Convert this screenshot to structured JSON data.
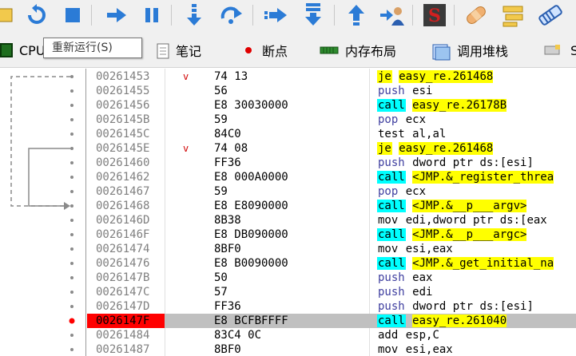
{
  "tabs": {
    "items": [
      {
        "label": "CPU"
      },
      {
        "label": "笔记"
      },
      {
        "label": "断点"
      },
      {
        "label": "内存布局"
      },
      {
        "label": "调用堆栈"
      },
      {
        "label": "S"
      }
    ]
  },
  "tooltip": "重新运行(S)",
  "toolbar": {
    "icons": [
      "open-file-icon",
      "restart-icon",
      "stop-icon",
      "run-icon",
      "pause-icon",
      "step-into-icon",
      "step-over-icon",
      "trace-into-icon",
      "trace-over-icon",
      "execute-till-return-icon",
      "run-to-user-code-icon",
      "script-icon",
      "patch-icon",
      "comment-icon",
      "label-icon"
    ]
  },
  "disassembly": {
    "rows": [
      {
        "addr": "00261453",
        "mark": "v",
        "bytes": "74 13",
        "mnemonic": "je",
        "operand": "easy_re.261468",
        "style": "jump"
      },
      {
        "addr": "00261455",
        "mark": "",
        "bytes": "56",
        "mnemonic": "push",
        "operand": "esi",
        "style": "push"
      },
      {
        "addr": "00261456",
        "mark": "",
        "bytes": "E8 30030000",
        "mnemonic": "call",
        "operand": "easy_re.26178B",
        "style": "call-local"
      },
      {
        "addr": "0026145B",
        "mark": "",
        "bytes": "59",
        "mnemonic": "pop",
        "operand": "ecx",
        "style": "pop"
      },
      {
        "addr": "0026145C",
        "mark": "",
        "bytes": "84C0",
        "mnemonic": "test",
        "operand": "al,al",
        "style": "plain"
      },
      {
        "addr": "0026145E",
        "mark": "v",
        "bytes": "74 08",
        "mnemonic": "je",
        "operand": "easy_re.261468",
        "style": "jump"
      },
      {
        "addr": "00261460",
        "mark": "",
        "bytes": "FF36",
        "mnemonic": "push",
        "operand": "dword ptr ds:[esi]",
        "style": "push"
      },
      {
        "addr": "00261462",
        "mark": "",
        "bytes": "E8 000A0000",
        "mnemonic": "call",
        "operand": "<JMP.&_register_threa",
        "style": "call-api"
      },
      {
        "addr": "00261467",
        "mark": "",
        "bytes": "59",
        "mnemonic": "pop",
        "operand": "ecx",
        "style": "pop"
      },
      {
        "addr": "00261468",
        "mark": "",
        "bytes": "E8 E8090000",
        "mnemonic": "call",
        "operand": "<JMP.&__p___argv>",
        "style": "call-api"
      },
      {
        "addr": "0026146D",
        "mark": "",
        "bytes": "8B38",
        "mnemonic": "mov",
        "operand": "edi,dword ptr ds:[eax",
        "style": "plain"
      },
      {
        "addr": "0026146F",
        "mark": "",
        "bytes": "E8 DB090000",
        "mnemonic": "call",
        "operand": "<JMP.&__p___argc>",
        "style": "call-api"
      },
      {
        "addr": "00261474",
        "mark": "",
        "bytes": "8BF0",
        "mnemonic": "mov",
        "operand": "esi,eax",
        "style": "plain"
      },
      {
        "addr": "00261476",
        "mark": "",
        "bytes": "E8 B0090000",
        "mnemonic": "call",
        "operand": "<JMP.&_get_initial_na",
        "style": "call-api"
      },
      {
        "addr": "0026147B",
        "mark": "",
        "bytes": "50",
        "mnemonic": "push",
        "operand": "eax",
        "style": "push"
      },
      {
        "addr": "0026147C",
        "mark": "",
        "bytes": "57",
        "mnemonic": "push",
        "operand": "edi",
        "style": "push"
      },
      {
        "addr": "0026147D",
        "mark": "",
        "bytes": "FF36",
        "mnemonic": "push",
        "operand": "dword ptr ds:[esi]",
        "style": "push"
      },
      {
        "addr": "0026147F",
        "mark": "",
        "bytes": "E8 BCFBFFFF",
        "mnemonic": "call",
        "operand": "easy_re.261040",
        "style": "call-local",
        "selected": true,
        "breakpoint": true
      },
      {
        "addr": "00261484",
        "mark": "",
        "bytes": "83C4 0C",
        "mnemonic": "add",
        "operand": "esp,C",
        "style": "plain"
      },
      {
        "addr": "00261487",
        "mark": "",
        "bytes": "8BF0",
        "mnemonic": "mov",
        "operand": "esi,eax",
        "style": "plain"
      }
    ]
  },
  "colors": {
    "jump_highlight": "#ffff00",
    "call_highlight": "#00ffff",
    "breakpoint": "#ff0000",
    "selected_row": "#c0c0c0",
    "address_text": "#7f7f7f"
  }
}
